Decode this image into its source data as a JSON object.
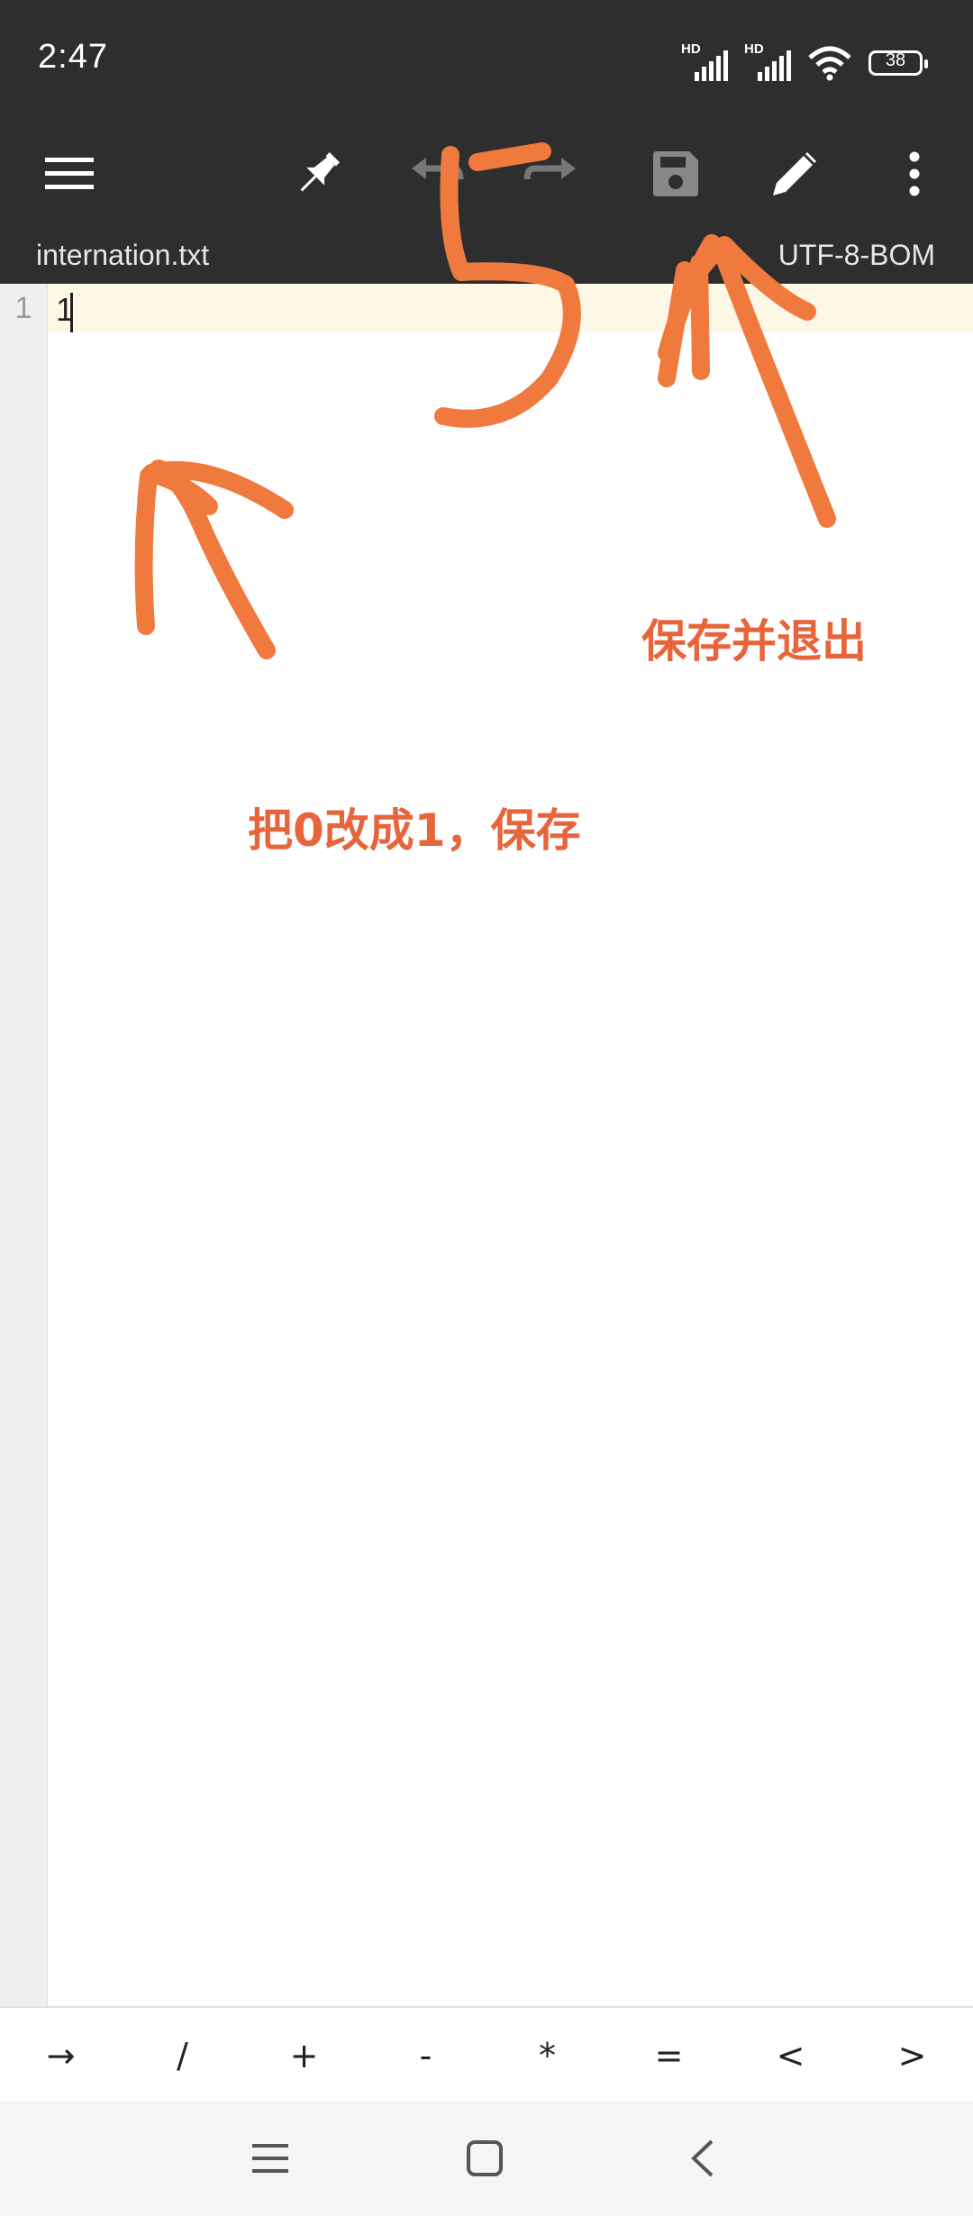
{
  "status_bar": {
    "time": "2:47",
    "signal1_label": "HD",
    "signal2_label": "HD",
    "battery": "38"
  },
  "toolbar": {
    "icons": [
      "menu-icon",
      "pin-icon",
      "undo-icon",
      "redo-icon",
      "save-icon",
      "edit-icon",
      "more-vert-icon"
    ]
  },
  "file": {
    "name": "internation.txt",
    "encoding": "UTF-8-BOM"
  },
  "editor": {
    "line_number": "1",
    "line_text": "1"
  },
  "keybar": {
    "keys": [
      "→",
      "/",
      "+",
      "-",
      "*",
      "=",
      "<",
      ">"
    ]
  },
  "annotations": {
    "edit_note": "把0改成1，保存",
    "save_note": "保存并退出"
  },
  "colors": {
    "toolbar_bg": "#2e2e2e",
    "annotation": "#f07a3e",
    "current_line": "#fdf8e6"
  }
}
